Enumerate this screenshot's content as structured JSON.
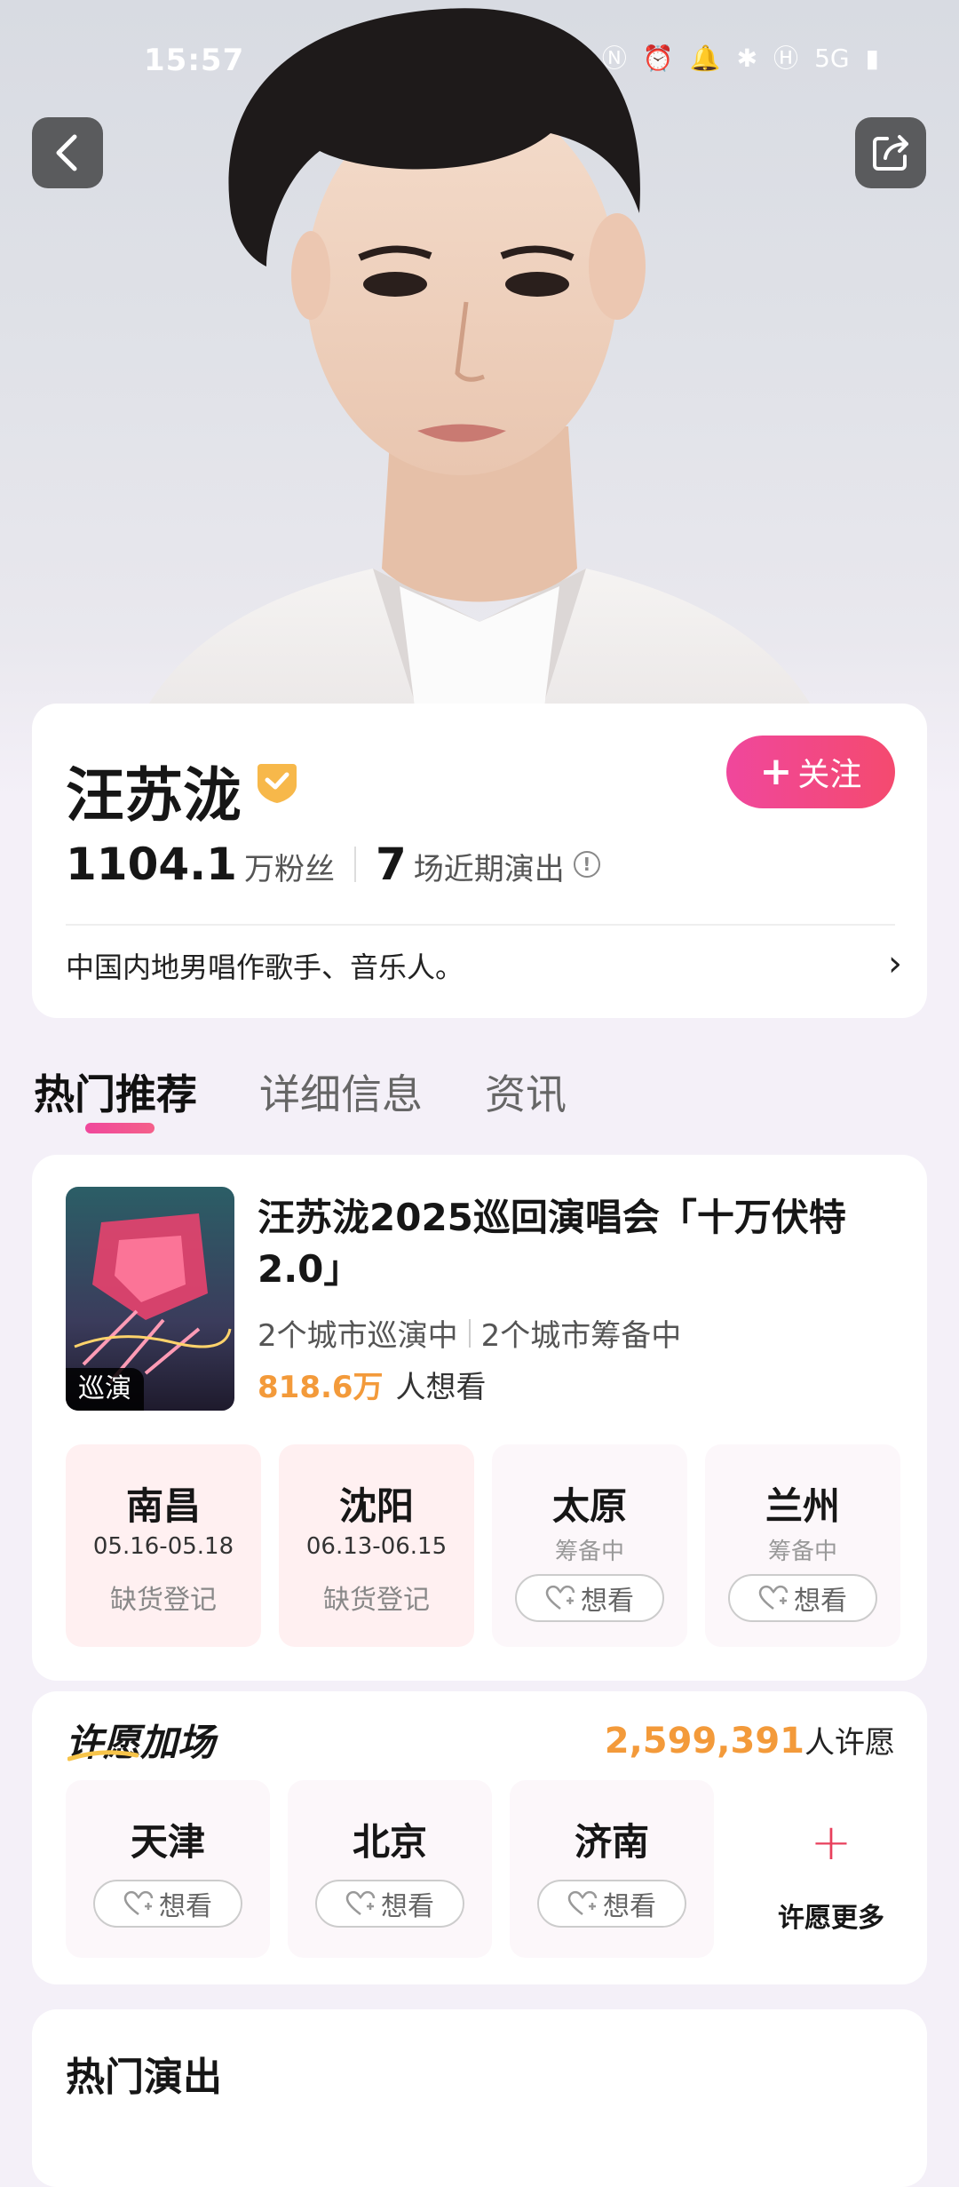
{
  "status_bar": {
    "time": "15:57",
    "icons": [
      "nfc-icon",
      "alarm-icon",
      "bell-icon",
      "bluetooth-icon",
      "hd-icon",
      "signal-5g-icon",
      "battery-icon"
    ],
    "icon_glyphs": [
      "Ⓝ",
      "⏰",
      "🔔",
      "✱",
      "Ⓗ",
      "5G",
      "▮"
    ]
  },
  "artist": {
    "name": "汪苏泷",
    "follow_label": "关注",
    "fans_count": "1104.1",
    "fans_unit": "万粉丝",
    "shows_count": "7",
    "shows_unit": "场近期演出",
    "bio": "中国内地男唱作歌手、音乐人。"
  },
  "tabs": [
    {
      "label": "热门推荐",
      "active": true
    },
    {
      "label": "详细信息",
      "active": false
    },
    {
      "label": "资讯",
      "active": false
    }
  ],
  "tour": {
    "title": "汪苏泷2025巡回演唱会「十万伏特2.0」",
    "poster_tag": "巡演",
    "touring": "2个城市巡演中",
    "preparing": "2个城市筹备中",
    "want_count": "818.6万",
    "want_suffix": "人想看",
    "cities": [
      {
        "name": "南昌",
        "date": "05.16-05.18",
        "status": "缺货登记",
        "pending": false
      },
      {
        "name": "沈阳",
        "date": "06.13-06.15",
        "status": "缺货登记",
        "pending": false
      },
      {
        "name": "太原",
        "date": "筹备中",
        "status": "想看",
        "pending": true
      },
      {
        "name": "兰州",
        "date": "筹备中",
        "status": "想看",
        "pending": true
      }
    ]
  },
  "wish": {
    "title": "许愿加场",
    "count": "2,599,391",
    "count_suffix": "人许愿",
    "cities": [
      {
        "name": "天津",
        "button": "想看"
      },
      {
        "name": "北京",
        "button": "想看"
      },
      {
        "name": "济南",
        "button": "想看"
      }
    ],
    "more_label": "许愿更多"
  },
  "hot_shows": {
    "title": "热门演出"
  },
  "colors": {
    "accent_pink": "#f0479c",
    "accent_orange": "#f39a3a",
    "verified_gold": "#f7b84a"
  }
}
